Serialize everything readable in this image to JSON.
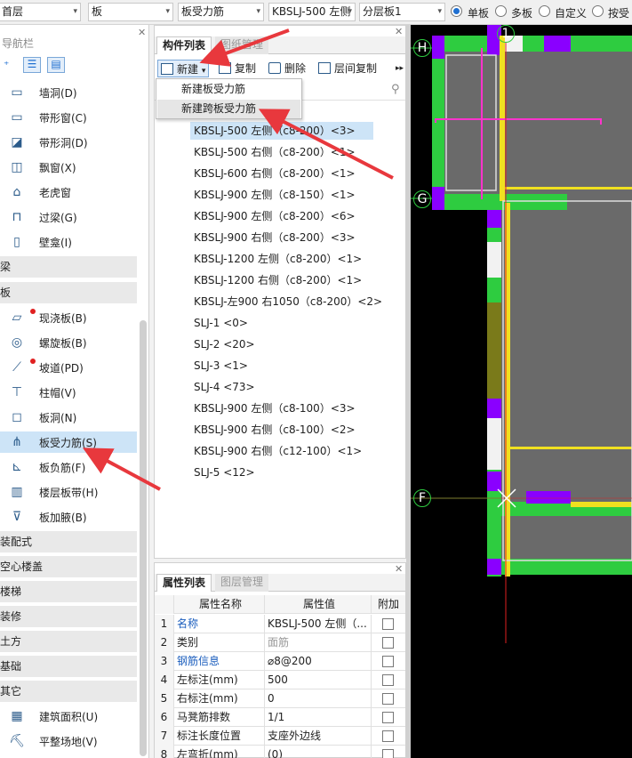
{
  "topbar": {
    "floor": "首层",
    "category": "板",
    "type": "板受力筋",
    "component": "KBSLJ-500 左侧",
    "layer": "分层板1",
    "radios": [
      {
        "label": "单板",
        "checked": true
      },
      {
        "label": "多板",
        "checked": false
      },
      {
        "label": "自定义",
        "checked": false
      },
      {
        "label": "按受",
        "checked": false
      }
    ]
  },
  "nav": {
    "title": "导航栏",
    "top_items": [
      {
        "label": "墙洞(D)",
        "icon": "wall-hole-icon",
        "glyph": "▭"
      },
      {
        "label": "带形窗(C)",
        "icon": "strip-window-icon",
        "glyph": "▭"
      },
      {
        "label": "带形洞(D)",
        "icon": "strip-hole-icon",
        "glyph": "◪"
      },
      {
        "label": "飘窗(X)",
        "icon": "bay-window-icon",
        "glyph": "◫"
      },
      {
        "label": "老虎窗",
        "icon": "dormer-icon",
        "glyph": "⌂"
      },
      {
        "label": "过梁(G)",
        "icon": "lintel-icon",
        "glyph": "⊓"
      },
      {
        "label": "壁龛(I)",
        "icon": "niche-icon",
        "glyph": "▯"
      }
    ],
    "cat_beam": "梁",
    "cat_slab": "板",
    "slab_items": [
      {
        "label": "现浇板(B)",
        "icon": "cast-slab-icon",
        "glyph": "▱",
        "dot": true
      },
      {
        "label": "螺旋板(B)",
        "icon": "spiral-slab-icon",
        "glyph": "◎",
        "dot": false
      },
      {
        "label": "坡道(PD)",
        "icon": "ramp-icon",
        "glyph": "⟋",
        "dot": true
      },
      {
        "label": "柱帽(V)",
        "icon": "column-cap-icon",
        "glyph": "⊤",
        "dot": false
      },
      {
        "label": "板洞(N)",
        "icon": "slab-hole-icon",
        "glyph": "◻",
        "dot": false
      },
      {
        "label": "板受力筋(S)",
        "icon": "slab-rebar-icon",
        "glyph": "⋔",
        "dot": false
      },
      {
        "label": "板负筋(F)",
        "icon": "neg-rebar-icon",
        "glyph": "⊾",
        "dot": false
      },
      {
        "label": "楼层板带(H)",
        "icon": "slab-band-icon",
        "glyph": "▥",
        "dot": false
      },
      {
        "label": "板加腋(B)",
        "icon": "haunch-icon",
        "glyph": "⊽",
        "dot": false
      }
    ],
    "categories": [
      "装配式",
      "空心楼盖",
      "楼梯",
      "装修",
      "土方",
      "基础",
      "其它"
    ],
    "other_items": [
      {
        "label": "建筑面积(U)",
        "icon": "area-icon",
        "glyph": "▦"
      },
      {
        "label": "平整场地(V)",
        "icon": "site-icon",
        "glyph": "⛏"
      }
    ]
  },
  "component_panel": {
    "tab_active": "构件列表",
    "tab_inactive": "图纸管理",
    "new_label": "新建",
    "copy_label": "复制",
    "delete_label": "删除",
    "floor_copy_label": "层间复制",
    "search_placeholder": "",
    "dropdown": [
      "新建板受力筋",
      "新建跨板受力筋"
    ],
    "items": [
      "KBSLJ-500 左侧（c8-200）<3>",
      "KBSLJ-500 右侧（c8-200）<1>",
      "KBSLJ-600 右侧（c8-200）<1>",
      "KBSLJ-900 左侧（c8-150）<1>",
      "KBSLJ-900 左侧（c8-200）<6>",
      "KBSLJ-900 右侧（c8-200）<3>",
      "KBSLJ-1200 左侧（c8-200）<1>",
      "KBSLJ-1200 右侧（c8-200）<1>",
      "KBSLJ-左900 右1050（c8-200）<2>",
      "SLJ-1 <0>",
      "SLJ-2 <20>",
      "SLJ-3 <1>",
      "SLJ-4 <73>",
      "KBSLJ-900 左侧（c8-100）<3>",
      "KBSLJ-900 右侧（c8-100）<2>",
      "KBSLJ-900 右侧（c12-100）<1>",
      "SLJ-5 <12>"
    ]
  },
  "properties": {
    "tab_active": "属性列表",
    "tab_inactive": "图层管理",
    "headers": [
      "属性名称",
      "属性值",
      "附加"
    ],
    "rows": [
      {
        "n": "1",
        "name": "名称",
        "value": "KBSLJ-500 左侧（...",
        "name_blue": true,
        "value_gray": false
      },
      {
        "n": "2",
        "name": "类别",
        "value": "面筋",
        "name_blue": false,
        "value_gray": true
      },
      {
        "n": "3",
        "name": "钢筋信息",
        "value": "⌀8@200",
        "name_blue": true,
        "value_gray": false
      },
      {
        "n": "4",
        "name": "左标注(mm)",
        "value": "500",
        "name_blue": false,
        "value_gray": false
      },
      {
        "n": "5",
        "name": "右标注(mm)",
        "value": "0",
        "name_blue": false,
        "value_gray": false
      },
      {
        "n": "6",
        "name": "马凳筋排数",
        "value": "1/1",
        "name_blue": false,
        "value_gray": false
      },
      {
        "n": "7",
        "name": "标注长度位置",
        "value": "支座外边线",
        "name_blue": false,
        "value_gray": false
      },
      {
        "n": "8",
        "name": "左弯折(mm)",
        "value": "(0)",
        "name_blue": false,
        "value_gray": false
      }
    ]
  },
  "canvas": {
    "axis_labels": [
      "H",
      "G",
      "F",
      "1"
    ],
    "colors": {
      "beam": "#2ecc40",
      "rebar": "#f0e020",
      "highlight": "#ff33cc",
      "axis_line": "#ff2020",
      "purple": "#8a00ff",
      "slab": "#6a6a6a"
    }
  },
  "annotations": {
    "arrow_color": "#e8383d"
  }
}
